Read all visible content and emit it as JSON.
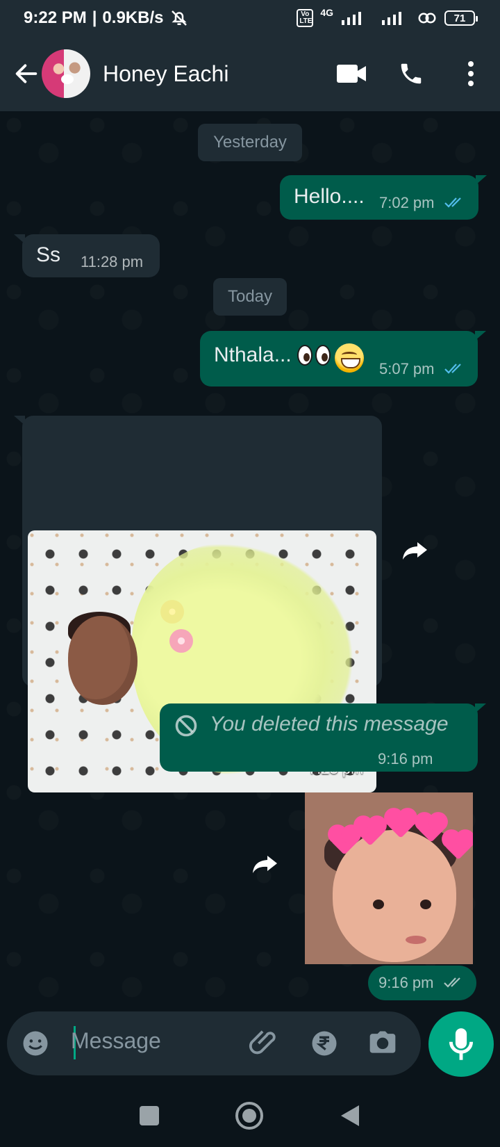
{
  "status_bar": {
    "time": "9:22 PM",
    "speed": "0.9KB/s",
    "volte": "Vo LTE",
    "network": "4G",
    "battery": "71"
  },
  "header": {
    "contact_name": "Honey Eachi"
  },
  "chat": {
    "date_labels": [
      "Yesterday",
      "Today"
    ],
    "messages": [
      {
        "text": "Hello....",
        "time": "7:02 pm"
      },
      {
        "text": "Ss",
        "time": "11:28 pm"
      },
      {
        "text": "Nthala...",
        "time": "5:07 pm"
      },
      {
        "time": "7:28 pm"
      },
      {
        "text": "You deleted this message",
        "time": "9:16 pm"
      },
      {
        "time": "9:16 pm"
      }
    ]
  },
  "composer": {
    "placeholder": "Message"
  },
  "colors": {
    "outgoing": "#005c4b",
    "incoming": "#1f2c34",
    "accent": "#00a884",
    "ticks": "#53bdeb"
  },
  "icons": {
    "back": "back-arrow-icon",
    "video": "video-call-icon",
    "phone": "voice-call-icon",
    "menu": "more-options-icon",
    "emoji": "emoji-icon",
    "attach": "attachment-icon",
    "payment": "payment-icon",
    "camera": "camera-icon",
    "mic": "microphone-icon"
  }
}
